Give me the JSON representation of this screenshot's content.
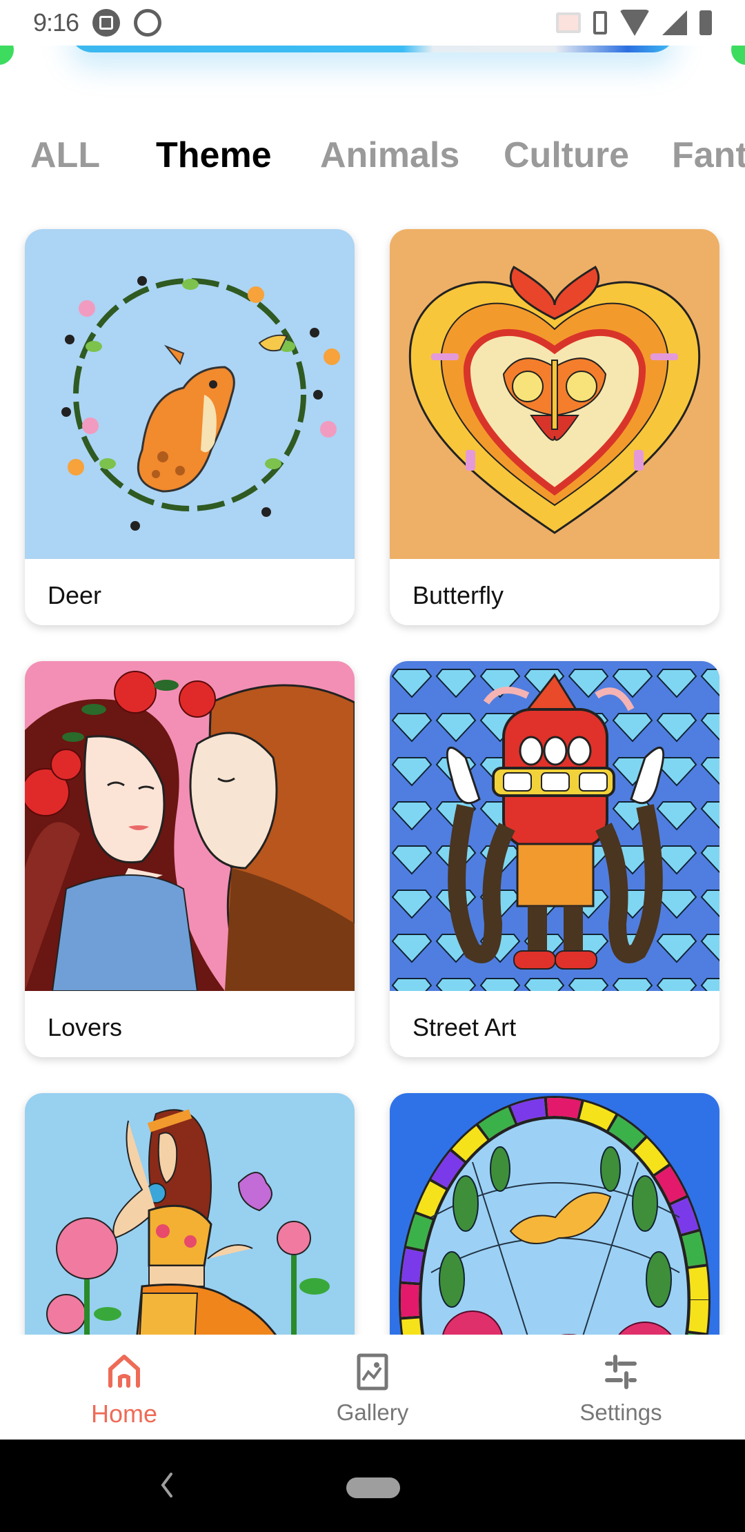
{
  "status_bar": {
    "time": "9:16",
    "left_icons": [
      "screenshot-edit-icon",
      "data-saver-icon"
    ],
    "right_icons": [
      "cast-icon",
      "vibrate-icon",
      "wifi-icon",
      "cell-signal-icon",
      "battery-charging-icon"
    ]
  },
  "categories": {
    "tabs": [
      {
        "label": "ALL",
        "active": false
      },
      {
        "label": "Theme",
        "active": true
      },
      {
        "label": "Animals",
        "active": false
      },
      {
        "label": "Culture",
        "active": false
      },
      {
        "label": "Fant",
        "active": false
      }
    ],
    "highlight_color": "#fde96b"
  },
  "cards": [
    {
      "title": "Deer",
      "image": "deer-in-floral-wreath",
      "bg": "#acd4f4"
    },
    {
      "title": "Butterfly",
      "image": "butterfly-heart-mandala",
      "bg": "#eeb066"
    },
    {
      "title": "Lovers",
      "image": "couple-with-roses",
      "bg": "#f38fb4"
    },
    {
      "title": "Street Art",
      "image": "cartoon-character-with-diamonds",
      "bg": "#4f7ee0"
    },
    {
      "title": "",
      "image": "woman-with-roses-and-butterfly",
      "bg": "#98d0f0"
    },
    {
      "title": "",
      "image": "stained-glass-butterfly-roses",
      "bg": "#2f72e8"
    }
  ],
  "bottom_nav": {
    "items": [
      {
        "label": "Home",
        "icon": "home-icon",
        "active": true
      },
      {
        "label": "Gallery",
        "icon": "gallery-icon",
        "active": false
      },
      {
        "label": "Settings",
        "icon": "settings-sliders-icon",
        "active": false
      }
    ],
    "active_color": "#ee6b57",
    "inactive_color": "#777777"
  }
}
